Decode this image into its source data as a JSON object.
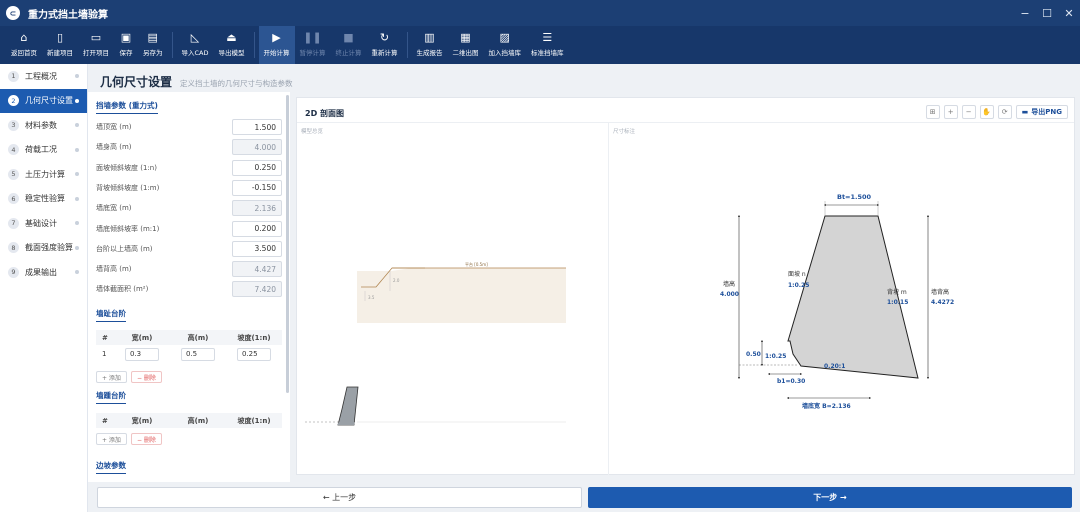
{
  "app": {
    "title": "重力式挡土墙验算",
    "logo_text": "⊂"
  },
  "window": {
    "minimize": "−",
    "maximize": "☐",
    "close": "✕"
  },
  "toolbar": {
    "items": [
      {
        "label": "返回首页",
        "icon": "home-icon",
        "glyph": "⌂"
      },
      {
        "label": "新建项目",
        "icon": "new-file-icon",
        "glyph": "▯"
      },
      {
        "label": "打开项目",
        "icon": "open-folder-icon",
        "glyph": "▭"
      },
      {
        "label": "保存",
        "icon": "save-icon",
        "glyph": "▣"
      },
      {
        "label": "另存为",
        "icon": "save-as-icon",
        "glyph": "▤"
      },
      {
        "label": "导入CAD",
        "icon": "import-cad-icon",
        "glyph": "◺"
      },
      {
        "label": "导出模型",
        "icon": "export-model-icon",
        "glyph": "⏏"
      },
      {
        "label": "开始计算",
        "icon": "play-icon",
        "glyph": "▶"
      },
      {
        "label": "暂停计算",
        "icon": "pause-icon",
        "glyph": "❚❚"
      },
      {
        "label": "终止计算",
        "icon": "stop-icon",
        "glyph": "■"
      },
      {
        "label": "重新计算",
        "icon": "refresh-icon",
        "glyph": "↻"
      },
      {
        "label": "生成报告",
        "icon": "report-icon",
        "glyph": "▥"
      },
      {
        "label": "二维出图",
        "icon": "drawing-icon",
        "glyph": "▦"
      },
      {
        "label": "加入挡墙库",
        "icon": "add-library-icon",
        "glyph": "▨"
      },
      {
        "label": "标准挡墙库",
        "icon": "library-icon",
        "glyph": "☰"
      }
    ]
  },
  "sidebar": {
    "items": [
      {
        "num": "1",
        "label": "工程概况"
      },
      {
        "num": "2",
        "label": "几何尺寸设置"
      },
      {
        "num": "3",
        "label": "材料参数"
      },
      {
        "num": "4",
        "label": "荷载工况"
      },
      {
        "num": "5",
        "label": "土压力计算"
      },
      {
        "num": "6",
        "label": "稳定性验算"
      },
      {
        "num": "7",
        "label": "基础设计"
      },
      {
        "num": "8",
        "label": "截面强度验算"
      },
      {
        "num": "9",
        "label": "成果输出"
      }
    ]
  },
  "page": {
    "title": "几何尺寸设置",
    "subtitle": "定义挡土墙的几何尺寸与构造参数"
  },
  "params": {
    "section_title": "挡墙参数 (重力式)",
    "rows": [
      {
        "label": "墙顶宽 (m)",
        "value": "1.500",
        "readonly": false
      },
      {
        "label": "墙身高 (m)",
        "value": "4.000",
        "readonly": true
      },
      {
        "label": "面坡倾斜坡度 (1:n)",
        "value": "0.250",
        "readonly": false
      },
      {
        "label": "背坡倾斜坡度 (1:m)",
        "value": "-0.150",
        "readonly": false
      },
      {
        "label": "墙底宽 (m)",
        "value": "2.136",
        "readonly": true
      },
      {
        "label": "墙底倾斜坡率 (m:1)",
        "value": "0.200",
        "readonly": false
      },
      {
        "label": "台阶以上墙高 (m)",
        "value": "3.500",
        "readonly": false
      },
      {
        "label": "墙背高 (m)",
        "value": "4.427",
        "readonly": true
      },
      {
        "label": "墙体截面积 (m²)",
        "value": "7.420",
        "readonly": true
      }
    ]
  },
  "toe_steps": {
    "title": "墙趾台阶",
    "headers": [
      "#",
      "宽(m)",
      "高(m)",
      "坡度(1:n)"
    ],
    "rows": [
      {
        "idx": "1",
        "width": "0.3",
        "height": "0.5",
        "slope": "0.25"
      }
    ],
    "add": "+ 添加",
    "del": "− 删除"
  },
  "heel_steps": {
    "title": "墙踵台阶",
    "headers": [
      "#",
      "宽(m)",
      "高(m)",
      "坡度(1:n)"
    ],
    "add": "+ 添加",
    "del": "− 删除"
  },
  "slope_params": {
    "title": "边坡参数"
  },
  "canvas": {
    "title": "2D 剖面图",
    "export": "导出PNG",
    "left_label": "模型总览",
    "right_label": "尺寸标注",
    "controls": {
      "fit": "⊞",
      "zoom_in": "+",
      "zoom_out": "−",
      "pan": "✋",
      "reset": "⟳"
    },
    "overview": {
      "slope_label": "平台 [0.5m]",
      "dim_a": "2.0",
      "dim_b": "3.5"
    },
    "dims": {
      "top_width": "Bt=1.500",
      "wall_height_label": "墙高",
      "wall_height_value": "4.000",
      "face_label": "面坡 n",
      "face_value": "1:0.25",
      "back_label": "背坡 m",
      "back_value": "1:0.15",
      "back_height_label": "墙背高",
      "back_height_value": "4.4272",
      "step_height": "0.50",
      "step_slope": "1:0.25",
      "base_slope": "0.20:1",
      "b1": "b1=0.30",
      "base_width": "墙底宽 B=2.136"
    }
  },
  "nav": {
    "prev": "← 上一步",
    "next": "下一步 →"
  },
  "colors": {
    "title_bar": "#1c3f74",
    "toolbar": "#17376a",
    "accent": "#1d5bb0",
    "wall_fill": "#d4d4d4",
    "soil": "#f5efe6",
    "dimension": "#1d4f9a"
  }
}
